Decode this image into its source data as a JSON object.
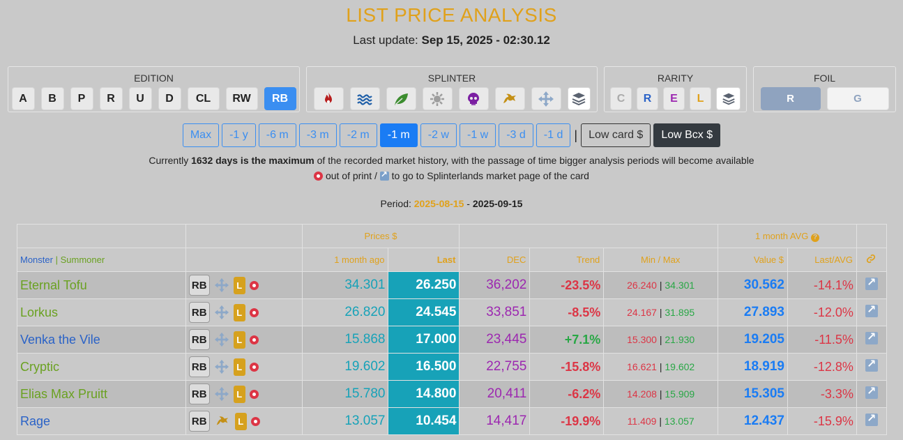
{
  "header": {
    "title": "LIST PRICE ANALYSIS",
    "update_label": "Last update:",
    "update_value": "Sep 15, 2025 - 02:30.12"
  },
  "filters": {
    "edition": {
      "title": "EDITION",
      "items": [
        "A",
        "B",
        "P",
        "R",
        "U",
        "D",
        "CL",
        "RW",
        "RB"
      ],
      "active": "RB"
    },
    "splinter": {
      "title": "SPLINTER",
      "items": [
        "fire-icon",
        "water-icon",
        "earth-icon",
        "life-icon",
        "death-icon",
        "dragon-icon",
        "neutral-icon",
        "all-layers-icon"
      ]
    },
    "rarity": {
      "title": "RARITY",
      "items": [
        "C",
        "R",
        "E",
        "L"
      ]
    },
    "foil": {
      "title": "FOIL",
      "items": [
        "R",
        "G"
      ],
      "active": "R"
    }
  },
  "periods": {
    "items": [
      "Max",
      "-1 y",
      "-6 m",
      "-3 m",
      "-2 m",
      "-1 m",
      "-2 w",
      "-1 w",
      "-3 d",
      "-1 d"
    ],
    "active": "-1 m",
    "separator": "|",
    "low_card": "Low card $",
    "low_bcx": "Low Bcx $"
  },
  "info": {
    "line1_a": "Currently",
    "line1_b": "1632 days is the maximum",
    "line1_c": "of the recorded market history, with the passage of time bigger analysis periods will become available",
    "line2_a": "out of print /",
    "line2_b": "to go to Splinterlands market page of the card",
    "period_label": "Period:",
    "period_from": "2025-08-15",
    "period_dash": "-",
    "period_to": "2025-09-15"
  },
  "table": {
    "group_prices": "Prices $",
    "group_avg": "1 month AVG",
    "col_monster": "Monster",
    "col_sep": "|",
    "col_summoner": "Summoner",
    "col_ago": "1 month ago",
    "col_last": "Last",
    "col_dec": "DEC",
    "col_trend": "Trend",
    "col_minmax": "Min / Max",
    "col_value": "Value $",
    "col_lastavg": "Last/AVG",
    "rows": [
      {
        "name": "Eternal Tofu",
        "color": "green",
        "edition": "RB",
        "splinter": "neutral-icon",
        "rarity": "L",
        "ago": "34.301",
        "last": "26.250",
        "dec": "36,202",
        "trend": "-23.5%",
        "min": "26.240",
        "max": "34.301",
        "value": "30.562",
        "lastavg": "-14.1%"
      },
      {
        "name": "Lorkus",
        "color": "green",
        "edition": "RB",
        "splinter": "neutral-icon",
        "rarity": "L",
        "ago": "26.820",
        "last": "24.545",
        "dec": "33,851",
        "trend": "-8.5%",
        "min": "24.167",
        "max": "31.895",
        "value": "27.893",
        "lastavg": "-12.0%"
      },
      {
        "name": "Venka the Vile",
        "color": "blue",
        "edition": "RB",
        "splinter": "neutral-icon",
        "rarity": "L",
        "ago": "15.868",
        "last": "17.000",
        "dec": "23,445",
        "trend": "+7.1%",
        "min": "15.300",
        "max": "21.930",
        "value": "19.205",
        "lastavg": "-11.5%"
      },
      {
        "name": "Cryptic",
        "color": "green",
        "edition": "RB",
        "splinter": "neutral-icon",
        "rarity": "L",
        "ago": "19.602",
        "last": "16.500",
        "dec": "22,755",
        "trend": "-15.8%",
        "min": "16.621",
        "max": "19.602",
        "value": "18.919",
        "lastavg": "-12.8%"
      },
      {
        "name": "Elias Max Pruitt",
        "color": "green",
        "edition": "RB",
        "splinter": "neutral-icon",
        "rarity": "L",
        "ago": "15.780",
        "last": "14.800",
        "dec": "20,411",
        "trend": "-6.2%",
        "min": "14.208",
        "max": "15.909",
        "value": "15.305",
        "lastavg": "-3.3%"
      },
      {
        "name": "Rage",
        "color": "blue",
        "edition": "RB",
        "splinter": "dragon-icon",
        "rarity": "L",
        "ago": "13.057",
        "last": "10.454",
        "dec": "14,417",
        "trend": "-19.9%",
        "min": "11.409",
        "max": "13.057",
        "value": "12.437",
        "lastavg": "-15.9%"
      }
    ]
  }
}
